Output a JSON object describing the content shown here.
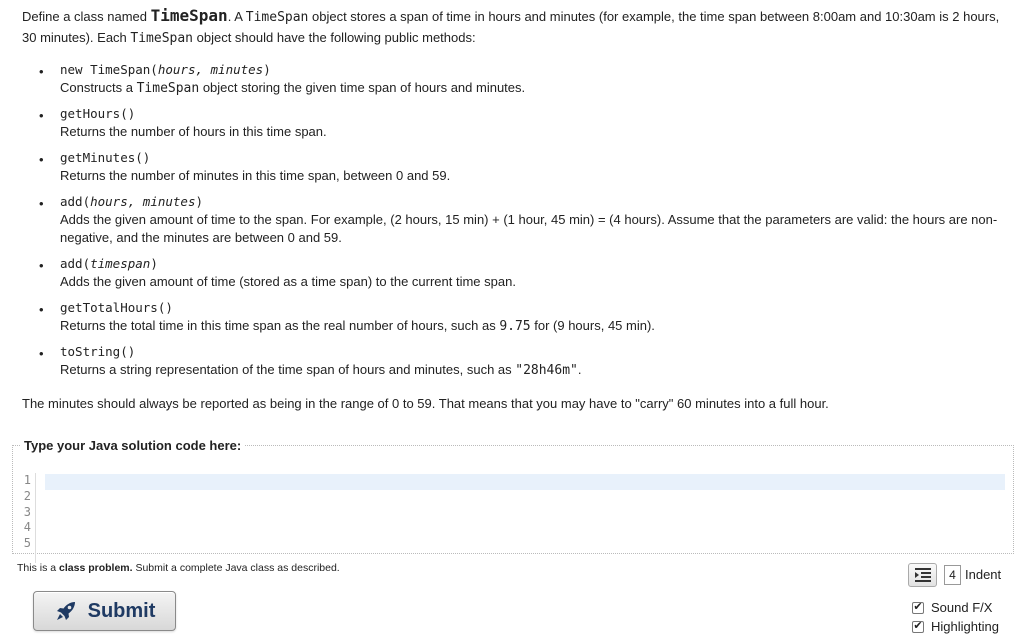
{
  "intro": {
    "p1": "Define a class named ",
    "class_name": "TimeSpan",
    "p2": ". A ",
    "p3_code": "TimeSpan",
    "p4": " object stores a span of time in hours and minutes (for example, the time span between 8:00am and 10:30am is 2 hours, 30 minutes). Each ",
    "p5_code": "TimeSpan",
    "p6": " object should have the following public methods:"
  },
  "methods": [
    {
      "sig_prefix": "new TimeSpan(",
      "sig_params": "hours, minutes",
      "sig_suffix": ")",
      "desc_a": "Constructs a ",
      "desc_code": "TimeSpan",
      "desc_b": " object storing the given time span of hours and minutes."
    },
    {
      "sig_prefix": "getHours()",
      "sig_params": "",
      "sig_suffix": "",
      "desc_a": "Returns the number of hours in this time span.",
      "desc_code": "",
      "desc_b": ""
    },
    {
      "sig_prefix": "getMinutes()",
      "sig_params": "",
      "sig_suffix": "",
      "desc_a": "Returns the number of minutes in this time span, between 0 and 59.",
      "desc_code": "",
      "desc_b": ""
    },
    {
      "sig_prefix": "add(",
      "sig_params": "hours, minutes",
      "sig_suffix": ")",
      "desc_a": "Adds the given amount of time to the span. For example, (2 hours, 15 min) + (1 hour, 45 min) = (4 hours). Assume that the parameters are valid: the hours are non-negative, and the minutes are between 0 and 59.",
      "desc_code": "",
      "desc_b": ""
    },
    {
      "sig_prefix": "add(",
      "sig_params": "timespan",
      "sig_suffix": ")",
      "desc_a": "Adds the given amount of time (stored as a time span) to the current time span.",
      "desc_code": "",
      "desc_b": ""
    },
    {
      "sig_prefix": "getTotalHours()",
      "sig_params": "",
      "sig_suffix": "",
      "desc_a": "Returns the total time in this time span as the real number of hours, such as ",
      "desc_code": "9.75",
      "desc_b": " for (9 hours, 45 min)."
    },
    {
      "sig_prefix": "toString()",
      "sig_params": "",
      "sig_suffix": "",
      "desc_a": "Returns a string representation of the time span of hours and minutes, such as ",
      "desc_code": "\"28h46m\"",
      "desc_b": "."
    }
  ],
  "closing": "The minutes should always be reported as being in the range of 0 to 59. That means that you may have to \"carry\" 60 minutes into a full hour.",
  "editor": {
    "legend": "Type your Java solution code here:",
    "line_numbers": [
      "1",
      "2",
      "3",
      "4",
      "5"
    ]
  },
  "hint": {
    "a": "This is a ",
    "b": "class problem.",
    "c": " Submit a complete Java class as described."
  },
  "controls": {
    "submit_label": "Submit",
    "submit_icon": "rocket-icon",
    "indent_value": "4",
    "indent_label": "Indent",
    "sound_label": "Sound F/X",
    "sound_checked": true,
    "highlighting_label": "Highlighting",
    "highlighting_checked": true
  }
}
